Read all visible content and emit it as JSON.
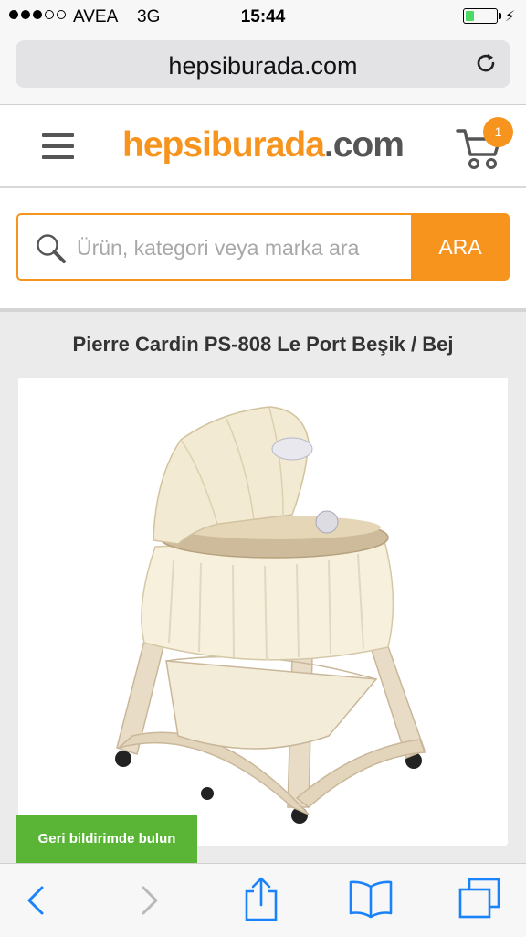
{
  "status_bar": {
    "carrier": "AVEA",
    "network": "3G",
    "time": "15:44",
    "signal_bars": 3,
    "signal_total": 5,
    "battery_level": 0.3,
    "battery_color": "#4cd964",
    "charging_icon": "lightning-icon"
  },
  "browser": {
    "url": "hepsiburada.com",
    "reload_icon": "reload-icon"
  },
  "header": {
    "menu_icon": "hamburger-menu-icon",
    "logo_main": "hepsiburada",
    "logo_suffix": ".com",
    "cart_icon": "shopping-cart-icon",
    "cart_count": "1"
  },
  "search": {
    "placeholder": "Ürün, kategori veya marka ara",
    "button_label": "ARA"
  },
  "product": {
    "title": "Pierre Cardin PS-808 Le Port Beşik / Bej"
  },
  "feedback": {
    "label": "Geri bildirimde bulun"
  },
  "toolbar": {
    "items": [
      "back-arrow-icon",
      "forward-arrow-icon",
      "share-icon",
      "bookmarks-icon",
      "tabs-icon"
    ]
  },
  "colors": {
    "brand_orange": "#f7941d",
    "logo_gray": "#555555",
    "feedback_green": "#5ab537",
    "ios_blue": "#1a82fb"
  }
}
